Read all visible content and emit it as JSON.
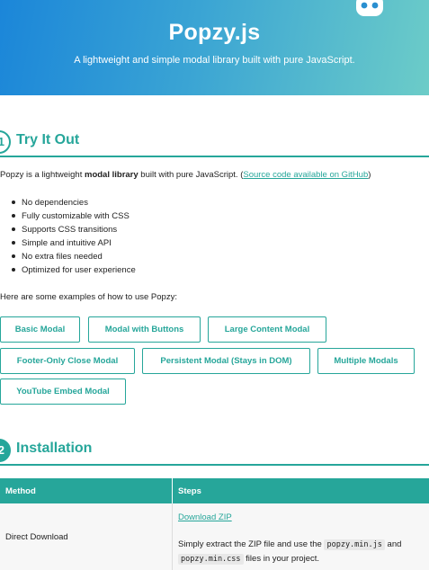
{
  "header": {
    "title": "Popzy.js",
    "subtitle": "A lightweight and simple modal library built with pure JavaScript.",
    "logo_icon": "robot-icon"
  },
  "try_it_out": {
    "title": "Try It Out",
    "intro_before": "Popzy is a lightweight ",
    "intro_bold": "modal library",
    "intro_middle": " built with pure JavaScript. (",
    "intro_link": "Source code available on GitHub",
    "intro_after": ")",
    "features": [
      "No dependencies",
      "Fully customizable with CSS",
      "Supports CSS transitions",
      "Simple and intuitive API",
      "No extra files needed",
      "Optimized for user experience"
    ],
    "examples_text": "Here are some examples of how to use Popzy:",
    "buttons": [
      "Basic Modal",
      "Modal with Buttons",
      "Large Content Modal",
      "Footer-Only Close Modal",
      "Persistent Modal (Stays in DOM)",
      "Multiple Modals",
      "YouTube Embed Modal"
    ]
  },
  "installation": {
    "title": "Installation",
    "headers": {
      "method": "Method",
      "steps": "Steps"
    },
    "row": {
      "method": "Direct Download",
      "link": "Download ZIP",
      "text_before": "Simply extract the ZIP file and use the ",
      "code1": "popzy.min.js",
      "text_mid": " and ",
      "code2": "popzy.min.css",
      "text_after": " files in your project."
    }
  },
  "colors": {
    "accent": "#26a69a",
    "gradient_start": "#1b86d9",
    "gradient_end": "#6cccc8"
  }
}
